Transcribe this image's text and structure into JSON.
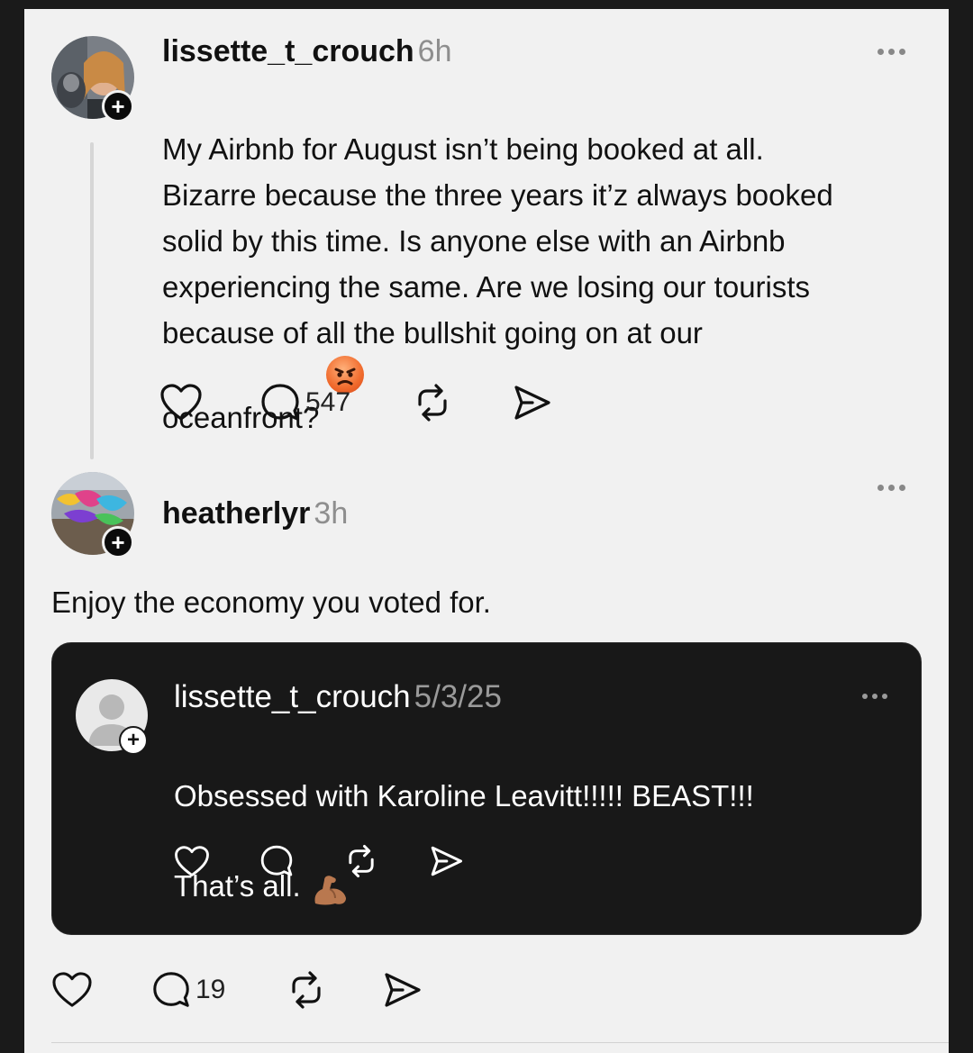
{
  "post": {
    "username": "lissette_t_crouch",
    "time": "6h",
    "text": "My Airbnb for August isn’t being booked at all.\nBizarre because the three years it’z always booked\nsolid by this time. Is anyone else with an Airbnb\nexperiencing the same. Are we losing our tourists\nbecause of all the bullshit going on at our\noceanfront?",
    "emoji_icon": "angry-face-emoji",
    "reply_count": "547"
  },
  "reply": {
    "username": "heatherlyr",
    "time": "3h",
    "text": "Enjoy the economy you voted for.",
    "reply_count": "19"
  },
  "quoted": {
    "username": "lissette_t_crouch",
    "time": "5/3/25",
    "text": "Obsessed with Karoline Leavitt!!!!! BEAST!!!\nThat’s all.",
    "emoji_icon": "flexed-biceps-emoji"
  },
  "icons": {
    "like": "heart-icon",
    "comment": "comment-icon",
    "repost": "repost-icon",
    "share": "send-icon",
    "more": "more-icon",
    "follow": "plus-icon"
  },
  "colors": {
    "background": "#f1f1f1",
    "text": "#111111",
    "muted": "#8e8e8e",
    "quote_bg": "#181818",
    "angry_emoji": "#f06a2c"
  }
}
